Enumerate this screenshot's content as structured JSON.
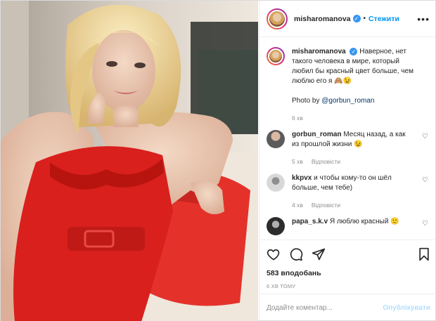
{
  "header": {
    "username": "misharomanova",
    "separator": "•",
    "follow_label": "Стежити",
    "more_glyph": "•••"
  },
  "caption": {
    "username": "misharomanova",
    "text": "Наверное, нет такого человека в мире, который любил бы красный цвет больше, чем люблю его я 🙈😉",
    "photo_prefix": "Photo by ",
    "photo_link": "@gorbun_roman",
    "time": "6 хв"
  },
  "comments": [
    {
      "username": "gorbun_roman",
      "text": "Месяц назад, а как из прошлой жизни 😉",
      "time": "5 хв",
      "reply": "Відповісти",
      "avatar_color": "#6b6b6b"
    },
    {
      "username": "kkpvx",
      "text": "и чтобы кому-то он шёл больше, чем тебе)",
      "time": "4 хв",
      "reply": "Відповісти",
      "avatar_color": "#cfcfcf"
    },
    {
      "username": "papa_s.k.v",
      "text": "Я люблю красный 🙂",
      "time": "",
      "reply": "",
      "avatar_color": "#3a3a3a"
    }
  ],
  "actions": {
    "likes": "583 вподобань",
    "posted": "6 хв тому"
  },
  "add_comment": {
    "placeholder": "Додайте коментар...",
    "publish_label": "Опублікувати"
  },
  "colors": {
    "accent": "#0095f6",
    "dress": "#d9201d",
    "pillow": "#e4322b"
  }
}
